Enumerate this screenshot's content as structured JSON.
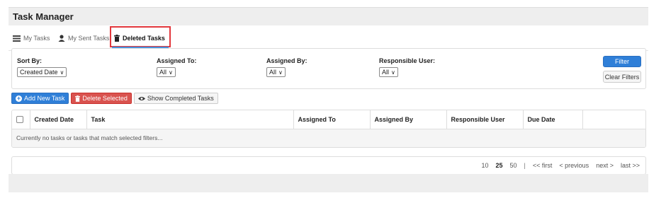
{
  "app": {
    "title": "Task Manager"
  },
  "nav": {
    "tabs": [
      {
        "label": "My Tasks",
        "icon": "list-icon"
      },
      {
        "label": "My Sent Tasks",
        "icon": "user-icon"
      },
      {
        "label": "Deleted Tasks",
        "icon": "trash-icon",
        "active": true
      }
    ],
    "accent_color": "#e2373c",
    "underline_color": "#4a90d9"
  },
  "filters": {
    "sort_by": {
      "label": "Sort By:",
      "value": "Created Date"
    },
    "assigned_to": {
      "label": "Assigned To:",
      "value": "All"
    },
    "assigned_by": {
      "label": "Assigned By:",
      "value": "All"
    },
    "responsible_user": {
      "label": "Responsible User:",
      "value": "All"
    },
    "filter_button": "Filter",
    "clear_button": "Clear Filters"
  },
  "actions": {
    "add_new": "Add New Task",
    "delete_selected": "Delete Selected",
    "show_completed": "Show Completed Tasks"
  },
  "table": {
    "headers": {
      "created_date": "Created Date",
      "task": "Task",
      "assigned_to": "Assigned To",
      "assigned_by": "Assigned By",
      "responsible_user": "Responsible User",
      "due_date": "Due Date"
    },
    "empty_message": "Currently no tasks or tasks that match selected filters..."
  },
  "pager": {
    "sizes": [
      "10",
      "25",
      "50"
    ],
    "current_size": "25",
    "separator": "|",
    "first": "<< first",
    "previous": "< previous",
    "next": "next >",
    "last": "last >>"
  },
  "colors": {
    "primary": "#2f7fd8",
    "danger": "#d9534f"
  }
}
